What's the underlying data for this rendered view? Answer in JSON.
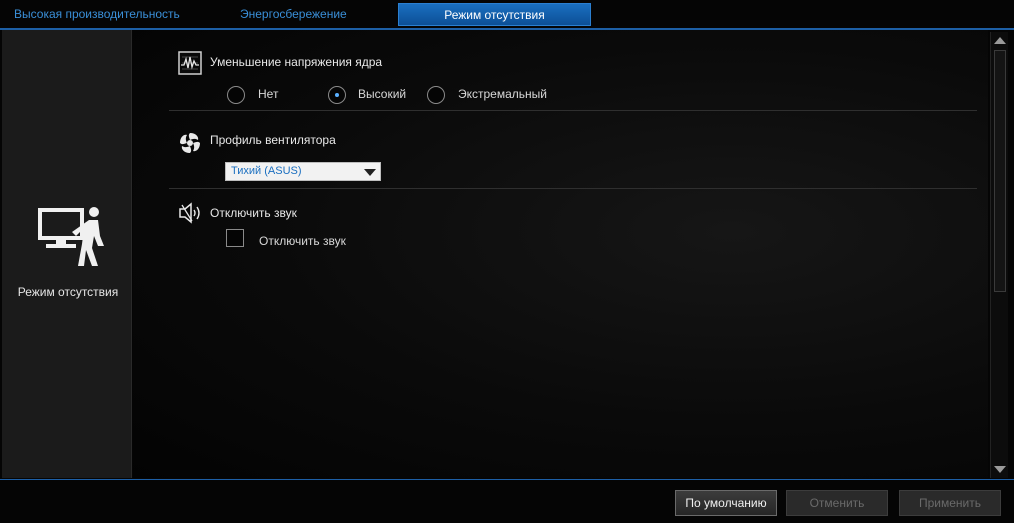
{
  "tabs": [
    {
      "label": "Высокая производительность",
      "active": false
    },
    {
      "label": "Энергосбережение",
      "active": false
    },
    {
      "label": "Режим отсутствия",
      "active": true
    }
  ],
  "sidebar": {
    "icon": "away-mode-icon",
    "label": "Режим отсутствия"
  },
  "core_voltage": {
    "title": "Уменьшение напряжения ядра",
    "icon": "voltage-chart-icon",
    "options": [
      "Нет",
      "Высокий",
      "Экстремальный"
    ],
    "selected": "Высокий"
  },
  "fan_profile": {
    "title": "Профиль вентилятора",
    "icon": "fan-icon",
    "selected": "Тихий (ASUS)"
  },
  "mute": {
    "title": "Отключить звук",
    "icon": "speaker-mute-icon",
    "checkbox_label": "Отключить звук",
    "checked": false
  },
  "buttons": {
    "default": "По умолчанию",
    "cancel": "Отменить",
    "apply": "Применить"
  },
  "colors": {
    "accent": "#1a6fc0",
    "tab_text": "#3a8fd8",
    "radio_dot": "#5ab0ff"
  }
}
